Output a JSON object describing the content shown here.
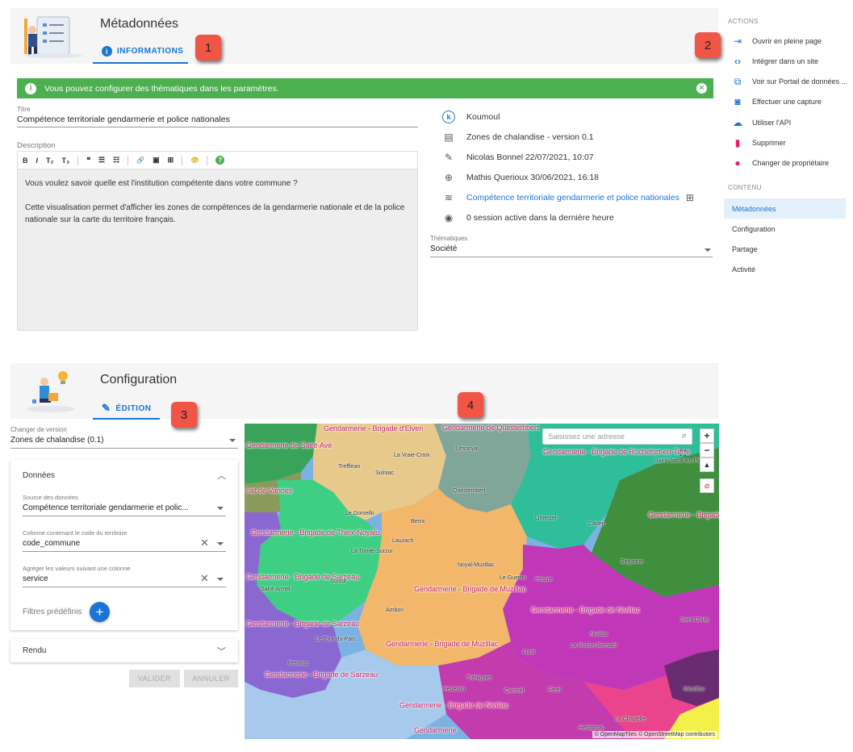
{
  "metadata_section": {
    "title": "Métadonnées",
    "tab_label": "INFORMATIONS",
    "badge": "1"
  },
  "actions_badge": "2",
  "config_badge": "3",
  "map_badge": "4",
  "alert": {
    "message": "Vous pouvez configurer des thématiques dans les paramètres."
  },
  "form": {
    "title_label": "Titre",
    "title_value": "Compétence territoriale gendarmerie et police nationales",
    "description_label": "Description",
    "description_p1": "Vous voulez savoir quelle est l'institution compétente dans votre commune ?",
    "description_p2": "Cette visualisation permet d'afficher les zones de compétences de la gendarmerie nationale et de la police nationale sur la carte du territoire français."
  },
  "toolbar": {
    "bold": "B",
    "italic": "I",
    "sub": "T₂",
    "sup": "T₃",
    "quote": "❝",
    "ul": "☰",
    "ol": "☷",
    "link": "🔗",
    "image": "▣",
    "table": "⊞",
    "preview": "👁",
    "help": "?"
  },
  "info": {
    "owner": "Koumoul",
    "dataset": "Zones de chalandise - version 0.1",
    "updated": "Nicolas Bonnel 22/07/2021, 10:07",
    "created": "Mathis Querioux 30/06/2021, 16:18",
    "source_link": "Compétence territoriale gendarmerie et police nationales",
    "sessions": "0 session active dans la dernière heure",
    "themes_label": "Thématiques",
    "themes_value": "Société"
  },
  "sidebar": {
    "actions_heading": "ACTIONS",
    "actions": [
      {
        "label": "Ouvrir en pleine page",
        "icon": "fullscreen-enter-icon"
      },
      {
        "label": "Intégrer dans un site",
        "icon": "code-icon"
      },
      {
        "label": "Voir sur Portail de données ...",
        "icon": "open-in-new-icon"
      },
      {
        "label": "Effectuer une capture",
        "icon": "camera-icon"
      },
      {
        "label": "Utiliser l'API",
        "icon": "cloud-icon"
      },
      {
        "label": "Supprimer",
        "icon": "trash-icon"
      },
      {
        "label": "Changer de propriétaire",
        "icon": "person-icon"
      }
    ],
    "content_heading": "CONTENU",
    "content_items": [
      "Métadonnées",
      "Configuration",
      "Partage",
      "Activité"
    ]
  },
  "config_section": {
    "title": "Configuration",
    "tab_label": "ÉDITION"
  },
  "config_form": {
    "version_label": "Changer de version",
    "version_value": "Zones de chalandise (0.1)",
    "data_header": "Données",
    "source_label": "Source des données",
    "source_value": "Compétence territoriale gendarmerie et polic...",
    "code_label": "Colonne contenant le code du territoire",
    "code_value": "code_commune",
    "aggregate_label": "Agréger les valeurs suivant une colonne",
    "aggregate_value": "service",
    "filters_label": "Filtres prédéfinis",
    "render_header": "Rendu",
    "validate_label": "VALIDER",
    "cancel_label": "ANNULER"
  },
  "map": {
    "search_placeholder": "Saisissez une adresse",
    "attribution": "© OpenMapTiles © OpenStreetMap contributors",
    "zone_labels": [
      "Gendarmerie - Brigade d'Elven",
      "Gendarmerie - Brigade de Rochefort-en-Terre",
      "Gendarmerie - Brigade d'Allaire",
      "Gendarmerie - Brigade de Theix-Noyalo",
      "Gendarmerie - Brigade de Muzillac",
      "Gendarmerie - Brigade de Nivillac",
      "Gendarmerie - Brigade de Sarzeau",
      "Gendarmerie - Brigade de Muzillac",
      "Gendarmerie - Brigade de Nivillac",
      "Gendarmerie - Brigade de Sarzeau",
      "Gendarmerie de Questembert",
      "Gendarmerie de Saint-Avé",
      "riat de Vannes",
      "Gendarmerie - Brigade de Sarzeau",
      "Gendarmerie"
    ],
    "town_labels": [
      "Trefflean",
      "La Vraie-Croix",
      "Sulniac",
      "Lesnoyal",
      "Questembert",
      "Le Gorvello",
      "Berric",
      "Lauzach",
      "La Trinité-Surzur",
      "Surzur",
      "Saint-Armel",
      "Noyal-Muzillac",
      "Le Guerno",
      "Péaule",
      "Ambon",
      "Arzal",
      "Nivillac",
      "La Roche-Bernard",
      "Béganne",
      "Saint Dolay",
      "Penvins",
      "Le Tour-du-Parc",
      "Tréhiguier",
      "Pénestin",
      "Camoël",
      "Férel",
      "Missillac",
      "La Chapelle-",
      "Herbignac",
      "Limerzel",
      "Caden",
      "Saint-Jacut-les-Pins"
    ]
  }
}
